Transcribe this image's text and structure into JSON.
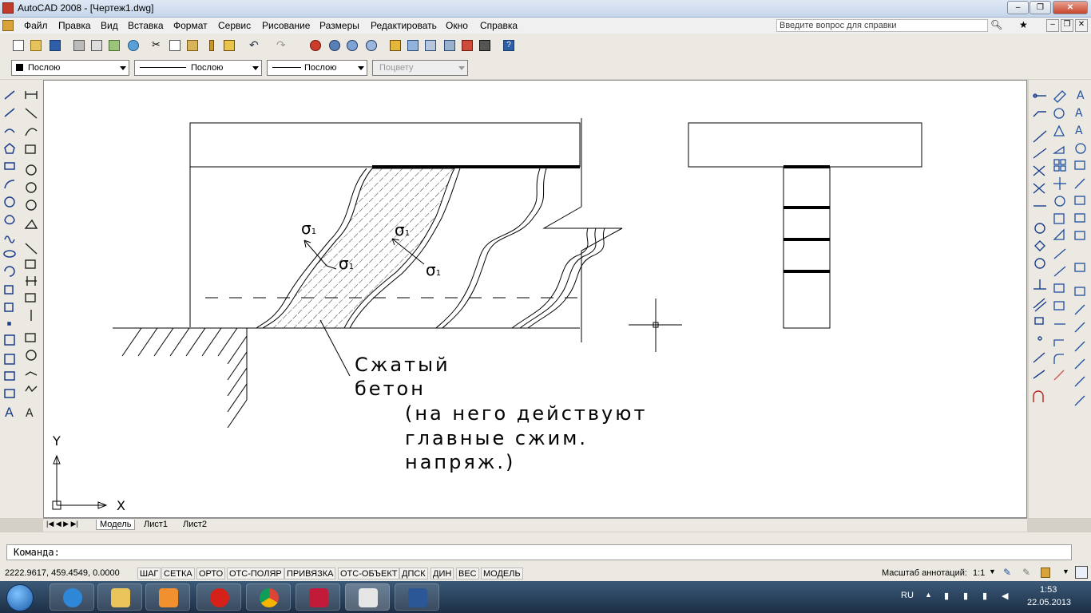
{
  "window": {
    "title": "AutoCAD 2008 - [Чертеж1.dwg]"
  },
  "menu": {
    "items": [
      "Файл",
      "Правка",
      "Вид",
      "Вставка",
      "Формат",
      "Сервис",
      "Рисование",
      "Размеры",
      "Редактировать",
      "Окно",
      "Справка"
    ]
  },
  "help_search": {
    "placeholder": "Введите вопрос для справки"
  },
  "properties": {
    "color": "Послою",
    "linetype": "Послою",
    "lineweight": "Послою",
    "plotstyle": "Поцвету"
  },
  "drawing": {
    "sigma_label": "σ",
    "sigma_subscript": "1",
    "annotation_lines": [
      "Сжатый",
      "бетон",
      "(на него действуют",
      "главные сжим.",
      "напряж.)"
    ],
    "ucs": {
      "x_label": "X",
      "y_label": "Y"
    }
  },
  "layout_tabs": [
    "Модель",
    "Лист1",
    "Лист2"
  ],
  "command_line": {
    "prompt": "Команда:"
  },
  "status_bar": {
    "coordinates": "2222.9617, 459.4549, 0.0000",
    "buttons": [
      "ШАГ",
      "СЕТКА",
      "ОРТО",
      "ОТС-ПОЛЯР",
      "ПРИВЯЗКА",
      "ОТС-ОБЪЕКТ",
      "ДПСК",
      "ДИН",
      "ВЕС",
      "МОДЕЛЬ"
    ],
    "annotation_scale_label": "Масштаб аннотаций:",
    "annotation_scale_value": "1:1"
  },
  "taskbar": {
    "apps": [
      "start-button",
      "internet-explorer",
      "file-explorer",
      "media-player",
      "opera",
      "chrome",
      "3g-modem",
      "autocad",
      "word"
    ],
    "language": "RU",
    "time": "1:53",
    "date": "22.05.2013"
  },
  "colors": {
    "accent": "#3b5a78",
    "close": "#c7452c"
  }
}
